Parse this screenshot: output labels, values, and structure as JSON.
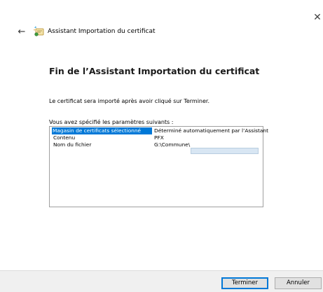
{
  "window": {
    "title": "Assistant Importation du certificat",
    "close_glyph": "✕",
    "back_glyph": "←"
  },
  "page": {
    "heading": "Fin de l’Assistant Importation du certificat",
    "intro": "Le certificat sera importé après avoir cliqué sur Terminer.",
    "params_label": "Vous avez spécifié les paramètres suivants :"
  },
  "params": [
    {
      "key": "Magasin de certificats sélectionné",
      "value": "Déterminé automatiquement par l’Assistant",
      "selected": true
    },
    {
      "key": "Contenu",
      "value": "PFX",
      "selected": false
    },
    {
      "key": "Nom du fichier",
      "value": "G:\\Commune\\",
      "selected": false
    }
  ],
  "buttons": {
    "finish": "Terminer",
    "cancel": "Annuler"
  },
  "colors": {
    "selection": "#0078d7",
    "primary_border": "#0078d7",
    "footer_bg": "#f0f0f0"
  },
  "icons": {
    "wizard": "certificate-wizard-icon",
    "back": "back-arrow-icon",
    "close": "close-icon"
  }
}
